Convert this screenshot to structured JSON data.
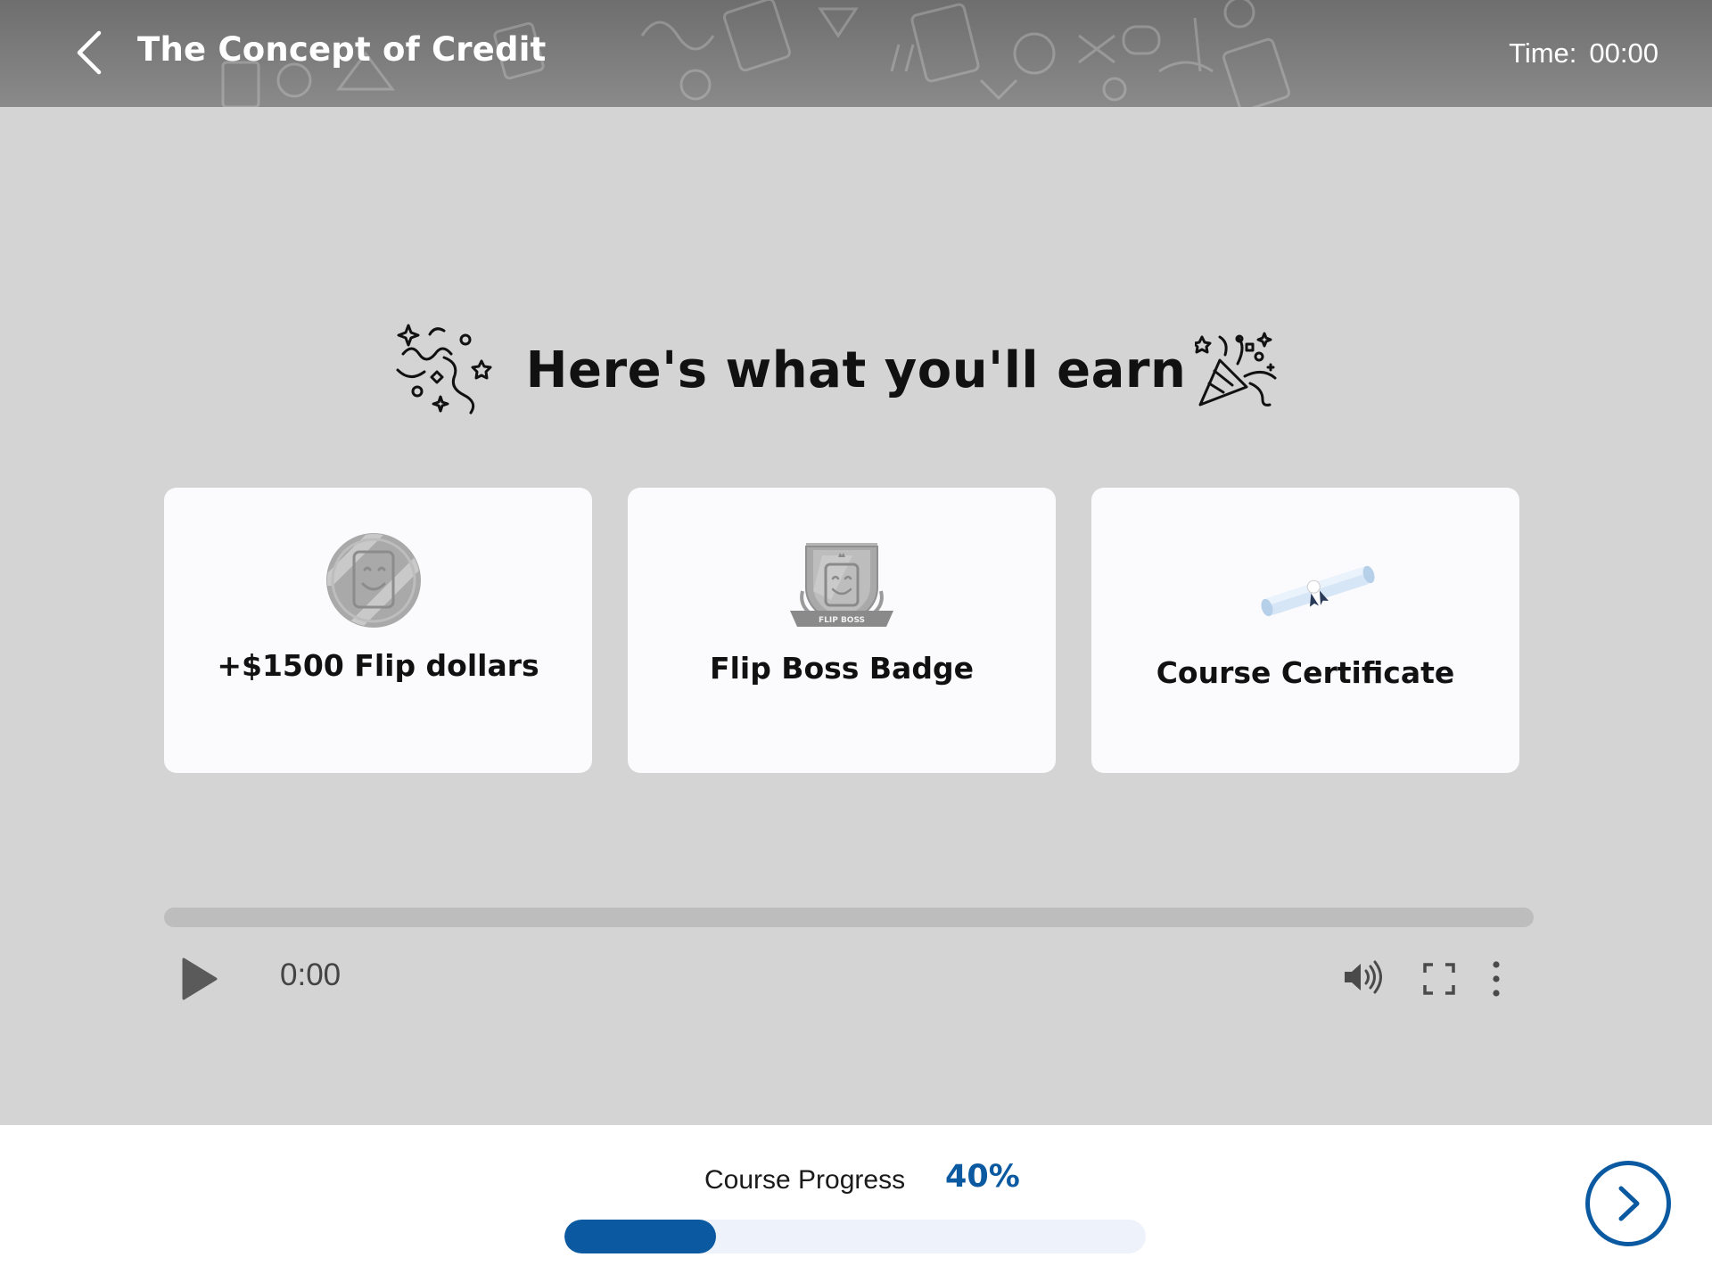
{
  "header": {
    "title": "The Concept of Credit",
    "time_label": "Time:",
    "time_value": "00:00"
  },
  "earn": {
    "title": "Here's what you'll earn"
  },
  "rewards": [
    {
      "label": "+$1500 Flip dollars",
      "icon": "coin-icon"
    },
    {
      "label": "Flip Boss Badge",
      "icon": "badge-icon",
      "badge_text": "FLIP BOSS"
    },
    {
      "label": "Course Certificate",
      "icon": "scroll-icon"
    }
  ],
  "audio": {
    "current_time": "0:00",
    "played_fraction": 0
  },
  "footer": {
    "progress_label": "Course Progress",
    "progress_percent_text": "40%",
    "progress_fraction": 0.26
  },
  "colors": {
    "accent": "#0b5aa1",
    "header_bg": "#7a7a7a",
    "page_bg": "#d4d4d4",
    "card_bg": "#fbfbfd"
  }
}
